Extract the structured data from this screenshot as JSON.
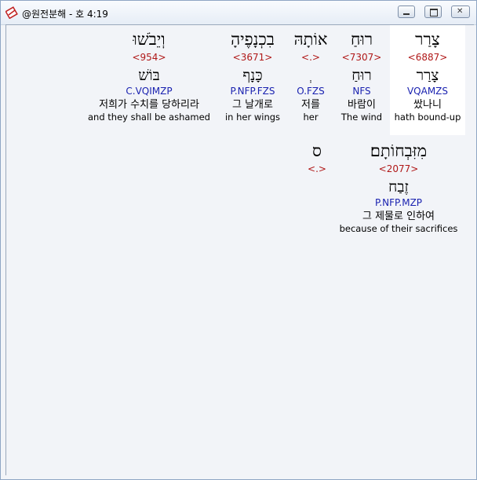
{
  "window": {
    "title": "@원전분해 - 호 4:19",
    "controls": {
      "minimize": "–",
      "maximize": "□",
      "close": "✕"
    }
  },
  "words": [
    {
      "hebrew": "צָרַר",
      "strong": "<6887>",
      "lemma": "צָרַר",
      "parse": "VQAMZS",
      "korean": "쌌나니",
      "english": "hath bound-up"
    },
    {
      "hebrew": "רוּחַ",
      "strong": "<7307>",
      "lemma": "רוּחַ",
      "parse": "NFS",
      "korean": "바람이",
      "english": "The wind"
    },
    {
      "hebrew": "אוֹתָהּ",
      "strong": "<.>",
      "lemma": "ְ",
      "parse": "O.FZS",
      "korean": "저를",
      "english": "her"
    },
    {
      "hebrew": "בִכְנָפֶיהָ",
      "strong": "<3671>",
      "lemma": "כָּנָף",
      "parse": "P.NFP.FZS",
      "korean": "그 날개로",
      "english": "in her wings"
    },
    {
      "hebrew": "וְיֵבֹשׁוּ",
      "strong": "<954>",
      "lemma": "בּוֹשׁ",
      "parse": "C.VQIMZP",
      "korean": "저희가 수치를 당하리라",
      "english": "and they shall be ashamed"
    },
    {
      "hebrew": "מִזִּבְחוֹתָם׃",
      "strong": "<2077>",
      "lemma": "זֶבַח",
      "parse": "P.NFP.MZP",
      "korean": "그 제물로 인하여",
      "english": "because of their sacrifices"
    },
    {
      "hebrew": "ס",
      "strong": "<.>",
      "lemma": "",
      "parse": "",
      "korean": "",
      "english": ""
    }
  ]
}
